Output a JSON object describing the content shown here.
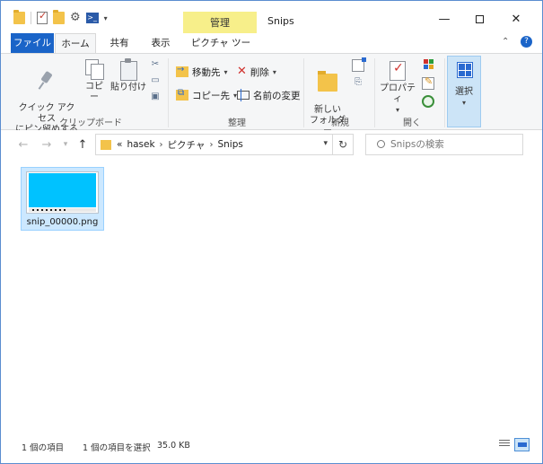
{
  "window": {
    "title": "Snips",
    "context_tab_label": "管理"
  },
  "tabs": {
    "file": "ファイル",
    "home": "ホーム",
    "share": "共有",
    "view": "表示",
    "picture_tools": "ピクチャ ツール"
  },
  "ribbon": {
    "clipboard": {
      "group_label": "クリップボード",
      "pin_quick_access": "クイック アクセス\nにピン留めする",
      "copy": "コピー",
      "paste": "貼り付け"
    },
    "organize": {
      "group_label": "整理",
      "move_to": "移動先",
      "copy_to": "コピー先",
      "delete": "削除",
      "rename": "名前の変更"
    },
    "new": {
      "group_label": "新規",
      "new_folder": "新しい\nフォルダー"
    },
    "open": {
      "group_label": "開く",
      "properties": "プロパティ"
    },
    "select": {
      "label": "選択"
    }
  },
  "address": {
    "overflow": "«",
    "crumbs": [
      "hasek",
      "ピクチャ",
      "Snips"
    ]
  },
  "search": {
    "placeholder": "Snipsの検索"
  },
  "files": [
    {
      "name": "snip_00000.png",
      "selected": true
    }
  ],
  "status": {
    "item_count": "1 個の項目",
    "selection": "1 個の項目を選択",
    "size": "35.0 KB"
  },
  "colors": {
    "accent": "#1a64c8",
    "context_tab": "#f7ef8a",
    "selection": "#cce8ff",
    "thumbnail_screen": "#00c2ff"
  }
}
